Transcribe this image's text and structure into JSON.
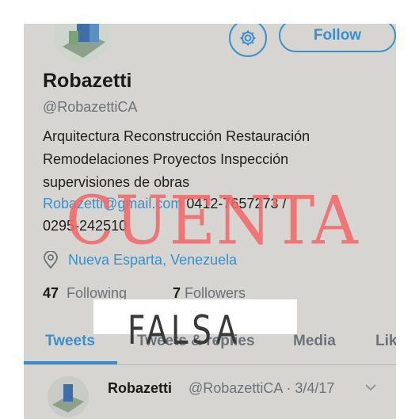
{
  "profile": {
    "follow_label": "Follow",
    "display_name": "Robazetti",
    "handle": "@RobazettiCA",
    "bio_lines": [
      "Arquitectura Reconstrucción Restauración",
      "Remodelaciones Proyectos Inspección",
      "supervisiones de obras"
    ],
    "email": "Robazetti@gmail.com",
    "phone_1": "0412-7657273 /",
    "phone_2": "0295-242510",
    "location": "Nueva Esparta, Venezuela",
    "following_count": "47",
    "following_label": "Following",
    "followers_count": "7",
    "followers_label": "Followers"
  },
  "tabs": [
    {
      "label": "Tweets",
      "active": true
    },
    {
      "label": "Tweets & replies",
      "active": false
    },
    {
      "label": "Media",
      "active": false
    },
    {
      "label": "Lik",
      "active": false
    }
  ],
  "tweet": {
    "author": "Robazetti",
    "meta": "@RobazettiCA · 3/4/17"
  },
  "overlay": {
    "stamp_top": "CUENTA",
    "stamp_bottom": "FALSA"
  },
  "icons": {
    "settings": "gear-icon",
    "location": "location-pin-icon",
    "menu": "chevron-down-icon"
  },
  "colors": {
    "accent": "#3a8fcb",
    "stamp_red": "#f26a6a",
    "background": "#d7d5d2"
  }
}
